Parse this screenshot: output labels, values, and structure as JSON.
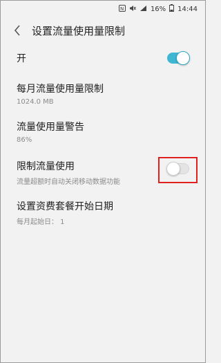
{
  "status_bar": {
    "nfc_icon": "nfc-icon",
    "mute_icon": "mute-icon",
    "signal_icon": "signal-icon",
    "battery_percent": "16%",
    "time": "14:44"
  },
  "header": {
    "title": "设置流量使用量限制",
    "back_icon": "back-arrow-icon"
  },
  "settings": {
    "master_switch": {
      "label": "开",
      "state": "on"
    },
    "monthly_limit": {
      "label": "每月流量使用量限制",
      "value": "1024.0 MB"
    },
    "warning": {
      "label": "流量使用量警告",
      "value": "86%"
    },
    "limit_usage": {
      "label": "限制流量使用",
      "description": "流量超额时自动关闭移动数据功能",
      "state": "off"
    },
    "cycle_start": {
      "label": "设置资费套餐开始日期",
      "value": "每月起始日： 1"
    }
  },
  "colors": {
    "accent": "#3fb7d3",
    "highlight": "#e01f1f",
    "background": "#f2f2f2"
  }
}
